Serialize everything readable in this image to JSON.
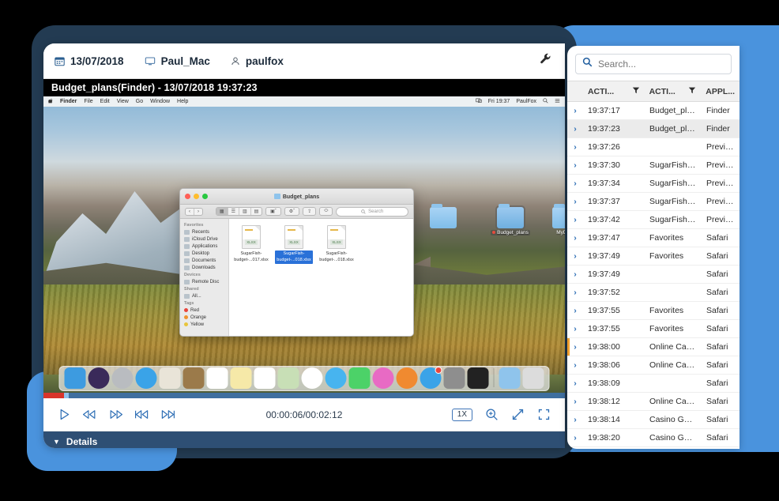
{
  "colors": {
    "blue": "#4a93dd",
    "dark_panel": "#233b52",
    "details_bar": "#2e4f74",
    "marker": "#f0a030",
    "accent_link": "#2f6fb5"
  },
  "header": {
    "date": "13/07/2018",
    "host": "Paul_Mac",
    "user": "paulfox",
    "calendar_icon": "calendar-icon",
    "monitor_icon": "monitor-icon",
    "person_icon": "person-icon",
    "settings_icon": "wrench-icon"
  },
  "title_bar": {
    "text": "Budget_plans(Finder) - 13/07/2018 19:37:23"
  },
  "video": {
    "macbar": {
      "apple": "",
      "menus": [
        "Finder",
        "File",
        "Edit",
        "View",
        "Go",
        "Window",
        "Help"
      ],
      "clock": "Fri 19:37",
      "user": "PaulFox",
      "search_icon": "search-icon",
      "menu_icon": "list-icon"
    },
    "desktop_folders": [
      {
        "label": "",
        "selected": false,
        "tagged": false
      },
      {
        "label": "Budget_plans",
        "selected": true,
        "tagged": true
      },
      {
        "label": "MyDocs",
        "selected": false,
        "tagged": false
      }
    ],
    "finder": {
      "window_title": "Budget_plans",
      "search_placeholder": "Search",
      "toolbar_icons": [
        "grid-view-icon",
        "list-view-icon",
        "column-view-icon",
        "gallery-view-icon",
        "arrange-icon",
        "action-icon",
        "share-icon",
        "tag-icon"
      ],
      "sidebar": [
        {
          "type": "group",
          "label": "Favorites"
        },
        {
          "type": "item",
          "label": "Recents"
        },
        {
          "type": "item",
          "label": "iCloud Drive"
        },
        {
          "type": "item",
          "label": "Applications"
        },
        {
          "type": "item",
          "label": "Desktop"
        },
        {
          "type": "item",
          "label": "Documents"
        },
        {
          "type": "item",
          "label": "Downloads"
        },
        {
          "type": "group",
          "label": "Devices"
        },
        {
          "type": "item",
          "label": "Remote Disc"
        },
        {
          "type": "group",
          "label": "Shared"
        },
        {
          "type": "item",
          "label": "All..."
        },
        {
          "type": "group",
          "label": "Tags"
        },
        {
          "type": "tag",
          "label": "Red",
          "color": "#e8453c"
        },
        {
          "type": "tag",
          "label": "Orange",
          "color": "#f0922f"
        },
        {
          "type": "tag",
          "label": "Yellow",
          "color": "#e8c53c"
        }
      ],
      "files": [
        {
          "name": "SugarFish-budget-...017.xlsx",
          "line1": "SugarFish-",
          "line2": "budget-...017.xlsx",
          "selected": false,
          "ext": "XLSX"
        },
        {
          "name": "SugarFish-budget-...018.xlsx",
          "line1": "SugarFish-",
          "line2": "budget-...018.xlsx",
          "selected": true,
          "ext": "XLSX"
        },
        {
          "name": "SugarFish-budget-...018.xlsx",
          "line1": "SugarFish-",
          "line2": "budget-...018.xlsx",
          "selected": false,
          "ext": "XLSX"
        }
      ]
    },
    "dock_items": [
      {
        "name": "finder-icon",
        "color": "#3d9be0",
        "round": false,
        "badge": false
      },
      {
        "name": "siri-icon",
        "color": "#3a2a5a",
        "round": true,
        "badge": false
      },
      {
        "name": "launchpad-icon",
        "color": "#b9bcc0",
        "round": true,
        "badge": false
      },
      {
        "name": "safari-icon",
        "color": "#3aa3e8",
        "round": true,
        "badge": false
      },
      {
        "name": "mail-icon",
        "color": "#e9e4d8",
        "round": false,
        "badge": false
      },
      {
        "name": "contacts-icon",
        "color": "#9b7a4a",
        "round": false,
        "badge": false
      },
      {
        "name": "calendar-icon",
        "color": "#ffffff",
        "round": false,
        "badge": false
      },
      {
        "name": "notes-icon",
        "color": "#f6e9a8",
        "round": false,
        "badge": false
      },
      {
        "name": "reminders-icon",
        "color": "#ffffff",
        "round": false,
        "badge": false
      },
      {
        "name": "maps-icon",
        "color": "#c8dfb6",
        "round": false,
        "badge": false
      },
      {
        "name": "photos-icon",
        "color": "#ffffff",
        "round": true,
        "badge": false
      },
      {
        "name": "messages-icon",
        "color": "#47b4ef",
        "round": true,
        "badge": false
      },
      {
        "name": "facetime-icon",
        "color": "#4cd268",
        "round": false,
        "badge": false
      },
      {
        "name": "itunes-icon",
        "color": "#e86ac4",
        "round": true,
        "badge": false
      },
      {
        "name": "ibooks-icon",
        "color": "#f08a30",
        "round": true,
        "badge": false
      },
      {
        "name": "app-store-icon",
        "color": "#3aa3e8",
        "round": true,
        "badge": true
      },
      {
        "name": "system-preferences-icon",
        "color": "#8e8e8e",
        "round": false,
        "badge": false
      },
      {
        "name": "reminders-dark-icon",
        "color": "#222222",
        "round": false,
        "badge": false
      },
      {
        "name": "downloads-folder-icon",
        "color": "#8fc4ec",
        "round": false,
        "badge": false
      },
      {
        "name": "trash-icon",
        "color": "#dcdcdc",
        "round": false,
        "badge": false
      }
    ]
  },
  "player": {
    "progress_percent": 4,
    "buttons": [
      {
        "name": "play-button",
        "glyph": "play"
      },
      {
        "name": "rewind-button",
        "glyph": "rewind"
      },
      {
        "name": "fast-forward-button",
        "glyph": "forward"
      },
      {
        "name": "previous-button",
        "glyph": "prev"
      },
      {
        "name": "next-button",
        "glyph": "next"
      }
    ],
    "time": "00:00:06/00:02:12",
    "speed": "1X",
    "zoom_icon": "zoom-in-icon",
    "expand_icon": "expand-icon",
    "fullscreen_icon": "fullscreen-icon"
  },
  "details": {
    "label": "Details",
    "caret": "▼"
  },
  "right_panel": {
    "search": {
      "placeholder": "Search...",
      "value": "",
      "icon": "search-icon"
    },
    "columns": [
      {
        "key": "expand",
        "label": "",
        "filter": false
      },
      {
        "key": "action_time",
        "label": "ACTI...",
        "filter": true
      },
      {
        "key": "action_name",
        "label": "ACTI...",
        "filter": true
      },
      {
        "key": "application",
        "label": "APPL...",
        "filter": false
      }
    ],
    "rows": [
      {
        "expand": "›",
        "time": "19:37:17",
        "action": "Budget_plans",
        "app": "Finder",
        "highlight": false,
        "marked": false
      },
      {
        "expand": "›",
        "time": "19:37:23",
        "action": "Budget_plans",
        "app": "Finder",
        "highlight": true,
        "marked": false
      },
      {
        "expand": "›",
        "time": "19:37:26",
        "action": "",
        "app": "Preview",
        "highlight": false,
        "marked": false
      },
      {
        "expand": "›",
        "time": "19:37:30",
        "action": "SugarFish-b...",
        "app": "Preview",
        "highlight": false,
        "marked": false
      },
      {
        "expand": "›",
        "time": "19:37:34",
        "action": "SugarFish-b...",
        "app": "Preview",
        "highlight": false,
        "marked": false
      },
      {
        "expand": "›",
        "time": "19:37:37",
        "action": "SugarFish-b...",
        "app": "Preview",
        "highlight": false,
        "marked": false
      },
      {
        "expand": "›",
        "time": "19:37:42",
        "action": "SugarFish-b...",
        "app": "Preview",
        "highlight": false,
        "marked": false
      },
      {
        "expand": "›",
        "time": "19:37:47",
        "action": "Favorites",
        "app": "Safari",
        "highlight": false,
        "marked": false
      },
      {
        "expand": "›",
        "time": "19:37:49",
        "action": "Favorites",
        "app": "Safari",
        "highlight": false,
        "marked": false
      },
      {
        "expand": "›",
        "time": "19:37:49",
        "action": "",
        "app": "Safari",
        "highlight": false,
        "marked": false
      },
      {
        "expand": "›",
        "time": "19:37:52",
        "action": "",
        "app": "Safari",
        "highlight": false,
        "marked": false
      },
      {
        "expand": "›",
        "time": "19:37:55",
        "action": "Favorites",
        "app": "Safari",
        "highlight": false,
        "marked": false
      },
      {
        "expand": "›",
        "time": "19:37:55",
        "action": "Favorites",
        "app": "Safari",
        "highlight": false,
        "marked": false
      },
      {
        "expand": "›",
        "time": "19:38:00",
        "action": "Online Casin...",
        "app": "Safari",
        "highlight": false,
        "marked": true
      },
      {
        "expand": "›",
        "time": "19:38:06",
        "action": "Online Casin...",
        "app": "Safari",
        "highlight": false,
        "marked": false
      },
      {
        "expand": "›",
        "time": "19:38:09",
        "action": "",
        "app": "Safari",
        "highlight": false,
        "marked": false
      },
      {
        "expand": "›",
        "time": "19:38:12",
        "action": "Online Casin...",
        "app": "Safari",
        "highlight": false,
        "marked": false
      },
      {
        "expand": "›",
        "time": "19:38:14",
        "action": "Casino Gam...",
        "app": "Safari",
        "highlight": false,
        "marked": false
      },
      {
        "expand": "›",
        "time": "19:38:20",
        "action": "Casino Gam...",
        "app": "Safari",
        "highlight": false,
        "marked": false
      }
    ]
  }
}
